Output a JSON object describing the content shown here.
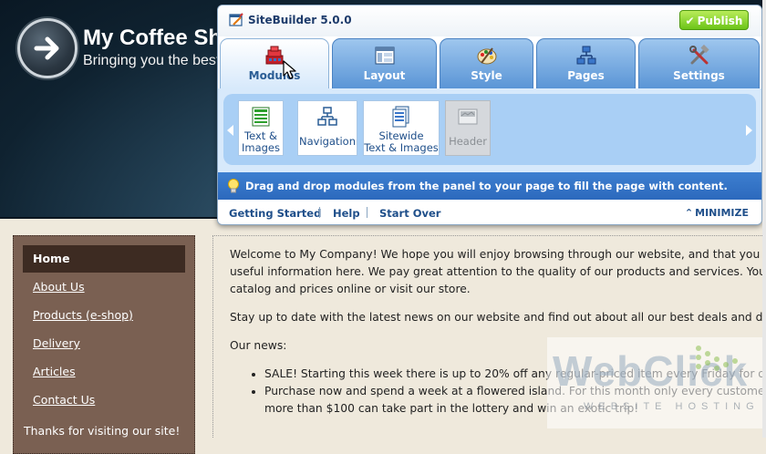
{
  "site": {
    "title": "My Coffee Sh",
    "tagline": "Bringing you the best",
    "nav": [
      {
        "label": "Home",
        "active": true
      },
      {
        "label": "About Us"
      },
      {
        "label": "Products (e-shop)"
      },
      {
        "label": "Delivery"
      },
      {
        "label": "Articles"
      },
      {
        "label": "Contact Us"
      }
    ],
    "nav_footer": "Thanks for visiting our site!",
    "content": {
      "p1_line1": "Welcome to My Company! We hope you will enjoy browsing through our website, and that you will fin",
      "p1_line2": "useful information here. We pay great attention to the quality of our products and services. You can",
      "p1_line3": "catalog and prices online or visit our store.",
      "p2": "Stay up to date with the latest news on our website and find out about all our best deals and discou",
      "news_heading": "Our news:",
      "bullet1": "SALE! Starting this week there is up to 20% off any regular-priced item every Friday for one n",
      "bullet2_line1": "Purchase now and spend a week at a flowered island. For this month only every customer who",
      "bullet2_line2": "more than $100 can take part in the lottery and win an exotic trip!"
    }
  },
  "watermark": {
    "brand": "WebClick",
    "sub": "WEBSITE HOSTING"
  },
  "sitebuilder": {
    "title": "SiteBuilder 5.0.0",
    "publish_label": "Publish",
    "tabs": [
      {
        "label": "Modules",
        "icon": "modules-icon",
        "active": true
      },
      {
        "label": "Layout",
        "icon": "layout-icon"
      },
      {
        "label": "Style",
        "icon": "style-palette-icon"
      },
      {
        "label": "Pages",
        "icon": "pages-sitemap-icon"
      },
      {
        "label": "Settings",
        "icon": "settings-tools-icon"
      }
    ],
    "modules": [
      {
        "label": "Text &\nImages",
        "icon": "text-images-icon"
      },
      {
        "label": "Navigation",
        "icon": "navigation-icon"
      },
      {
        "label": "Sitewide\nText & Images",
        "icon": "sitewide-text-images-icon"
      },
      {
        "label": "Header",
        "icon": "header-icon",
        "disabled": true
      }
    ],
    "hint": "Drag and drop modules from the panel to your page to fill the page with content.",
    "footer_links": [
      "Getting Started",
      "Help",
      "Start Over"
    ],
    "minimize_label": "MINIMIZE"
  },
  "colors": {
    "tab_blue": "#5a95d6",
    "hint_bar": "#2c69bd",
    "publish_green": "#6cc419",
    "nav_brown": "#7a6052",
    "nav_active": "#3d2b22"
  }
}
